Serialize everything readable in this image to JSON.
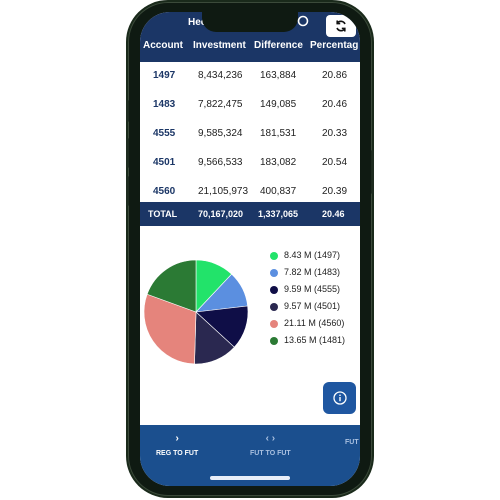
{
  "app": {
    "title": "Hec"
  },
  "table": {
    "headers": [
      "Account",
      "Investment",
      "Difference",
      "Percentag"
    ],
    "rows": [
      {
        "account": "1497",
        "investment": "8,434,236",
        "difference": "163,884",
        "percentage": "20.86"
      },
      {
        "account": "1483",
        "investment": "7,822,475",
        "difference": "149,085",
        "percentage": "20.46"
      },
      {
        "account": "4555",
        "investment": "9,585,324",
        "difference": "181,531",
        "percentage": "20.33"
      },
      {
        "account": "4501",
        "investment": "9,566,533",
        "difference": "183,082",
        "percentage": "20.54"
      },
      {
        "account": "4560",
        "investment": "21,105,973",
        "difference": "400,837",
        "percentage": "20.39"
      }
    ],
    "total": {
      "label": "TOTAL",
      "investment": "70,167,020",
      "difference": "1,337,065",
      "percentage": "20.46"
    }
  },
  "chart_data": {
    "type": "pie",
    "labels": [
      "8.43 M (1497)",
      "7.82 M (1483)",
      "9.59 M (4555)",
      "9.57 M (4501)",
      "21.11 M (4560)",
      "13.65 M (1481)"
    ],
    "values": [
      8.43,
      7.82,
      9.59,
      9.57,
      21.11,
      13.65
    ],
    "colors": [
      "#22e36a",
      "#5b8fe0",
      "#0f0e47",
      "#2a2850",
      "#e5847c",
      "#2b7a34"
    ],
    "legend_position": "right"
  },
  "nav": {
    "items": [
      {
        "label": "REG TO FUT",
        "icon": "chevron-right-icon",
        "glyph": "›",
        "active": true
      },
      {
        "label": "FUT TO FUT",
        "icon": "code-icon",
        "glyph": "‹ ›",
        "active": false
      },
      {
        "label": "FUT",
        "icon": "",
        "glyph": "",
        "active": false
      }
    ]
  },
  "colors": {
    "header_bg": "#1b3666",
    "nav_bg": "#1b4f8e",
    "accent": "#1f57a1",
    "account_text": "#1b3666"
  }
}
